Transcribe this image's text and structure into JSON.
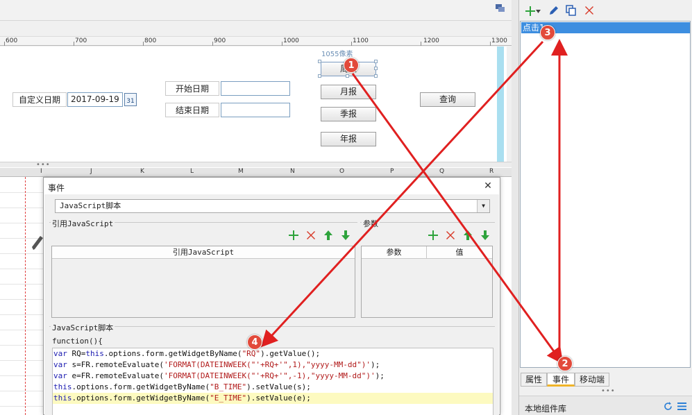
{
  "ruler": {
    "labels": [
      "600",
      "700",
      "800",
      "900",
      "1000",
      "1100",
      "1200",
      "1300"
    ]
  },
  "canvas": {
    "size_tip": "1055像素",
    "custom_date_label": "自定义日期",
    "custom_date_value": "2017-09-19",
    "calendar_icon_text": "31",
    "start_date_label": "开始日期",
    "end_date_label": "结束日期",
    "week_button": "周报",
    "month_button": "月报",
    "quarter_button": "季报",
    "year_button": "年报",
    "query_button": "查询"
  },
  "sheet": {
    "columns": [
      "I",
      "J",
      "K",
      "L",
      "M",
      "N",
      "O",
      "P",
      "Q",
      "R"
    ]
  },
  "dialog": {
    "title": "事件",
    "close": "✕",
    "script_type": "JavaScript脚本",
    "ref_js_group": "引用JavaScript",
    "params_group": "参数",
    "ref_js_header": "引用JavaScript",
    "param_header": "参数",
    "value_header": "值",
    "script_group": "JavaScript脚本",
    "func_open": "function(){"
  },
  "code": [
    [
      {
        "t": "var",
        "c": "kw"
      },
      {
        "t": " RQ=",
        "c": "plain"
      },
      {
        "t": "this",
        "c": "kw"
      },
      {
        "t": ".options.form.getWidgetByName(",
        "c": "plain"
      },
      {
        "t": "\"RQ\"",
        "c": "str"
      },
      {
        "t": ").getValue();",
        "c": "plain"
      }
    ],
    [
      {
        "t": "var",
        "c": "kw"
      },
      {
        "t": " s=FR.remoteEvaluate(",
        "c": "plain"
      },
      {
        "t": "'FORMAT(DATEINWEEK(\"'+RQ+'\",1),\"yyyy-MM-dd\")'",
        "c": "str"
      },
      {
        "t": ");",
        "c": "plain"
      }
    ],
    [
      {
        "t": "var",
        "c": "kw"
      },
      {
        "t": " e=FR.remoteEvaluate(",
        "c": "plain"
      },
      {
        "t": "'FORMAT(DATEINWEEK(\"'+RQ+'\",-1),\"yyyy-MM-dd\")'",
        "c": "str"
      },
      {
        "t": ");",
        "c": "plain"
      }
    ],
    [
      {
        "t": "this",
        "c": "kw"
      },
      {
        "t": ".options.form.getWidgetByName(",
        "c": "plain"
      },
      {
        "t": "\"B_TIME\"",
        "c": "str"
      },
      {
        "t": ").setValue(s);",
        "c": "plain"
      }
    ],
    [
      {
        "t": "this",
        "c": "kw"
      },
      {
        "t": ".options.form.getWidgetByName(",
        "c": "plain"
      },
      {
        "t": "\"E_TIME\"",
        "c": "str"
      },
      {
        "t": ").setValue(e);",
        "c": "plain"
      }
    ]
  ],
  "right_panel": {
    "event_item": "点击1",
    "tab_properties": "属性",
    "tab_events": "事件",
    "tab_mobile": "移动端",
    "local_lib": "本地组件库"
  },
  "annotations": [
    "1",
    "2",
    "3",
    "4"
  ],
  "colors": {
    "arrow": "#e02020",
    "badge": "#e24a3b",
    "selected": "#3d8ee0"
  }
}
